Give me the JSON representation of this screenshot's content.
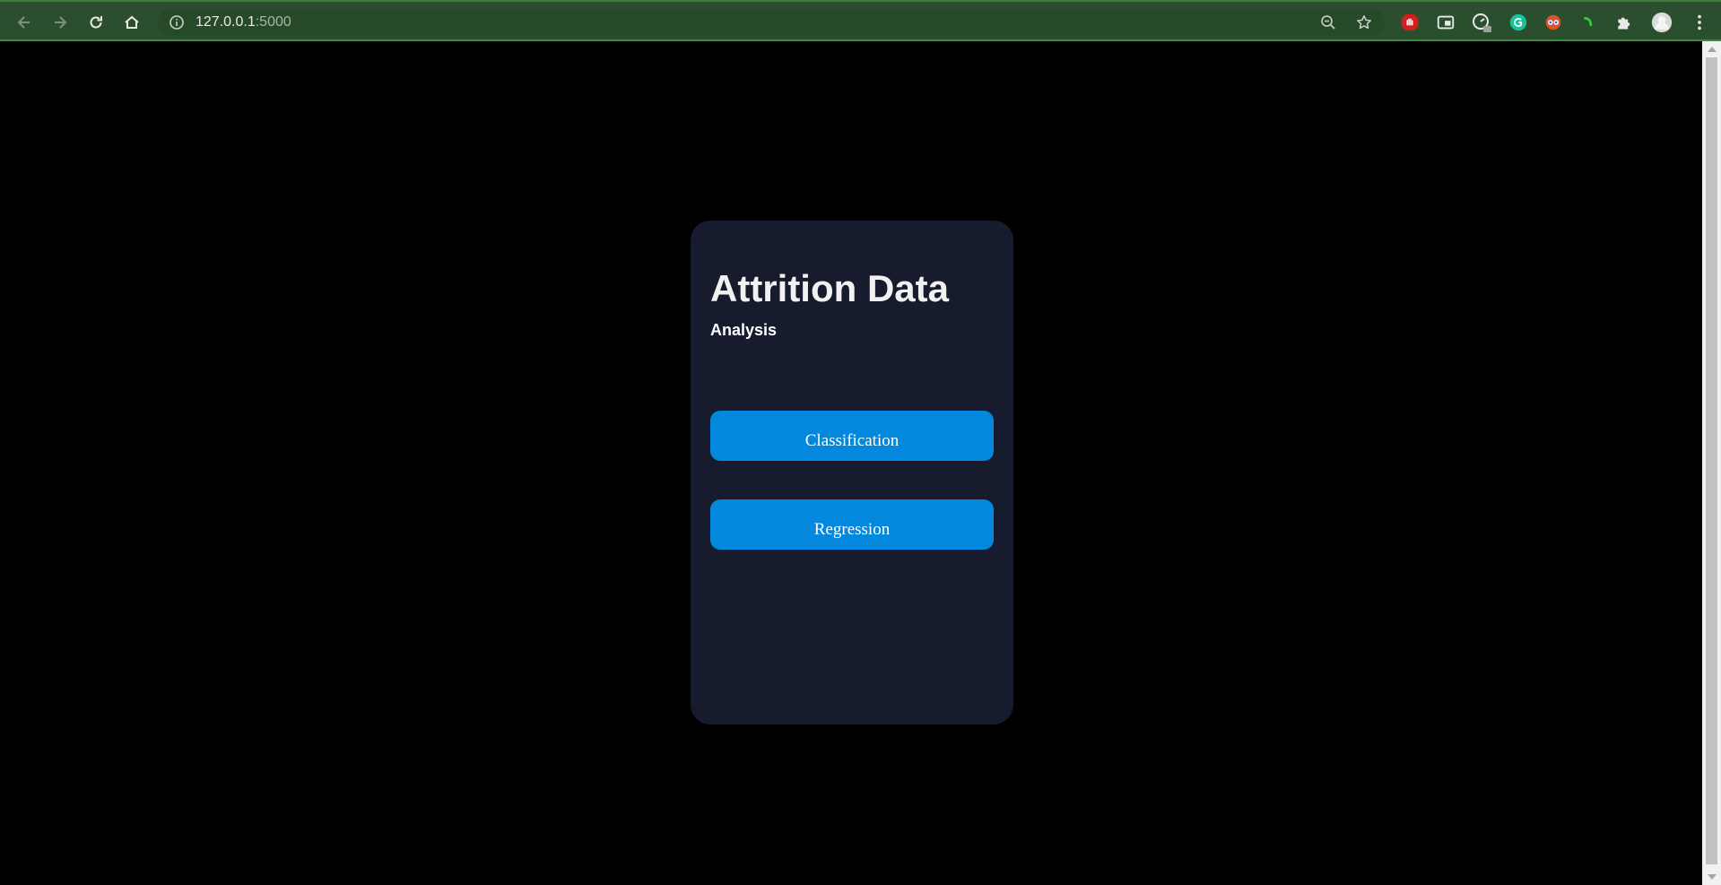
{
  "browser": {
    "url_host": "127.0.0.1",
    "url_port": ":5000"
  },
  "page": {
    "title": "Attrition Data",
    "subtitle": "Analysis",
    "buttons": {
      "classification": "Classification",
      "regression": "Regression"
    }
  },
  "colors": {
    "page_background": "#000000",
    "card_background": "#161b2d",
    "button_accent": "#0388dd",
    "chrome_background": "#2b4f2e"
  },
  "icons": {
    "back": "arrow-left-icon",
    "forward": "arrow-right-icon",
    "reload": "reload-icon",
    "home": "home-icon",
    "site_info": "info-icon",
    "zoom": "zoom-out-icon",
    "bookmark": "star-icon",
    "extensions": "puzzle-icon",
    "profile": "avatar",
    "menu": "kebab-menu-icon"
  }
}
